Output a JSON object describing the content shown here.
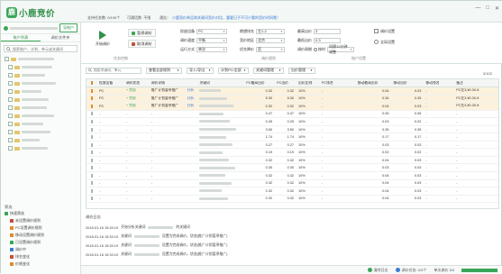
{
  "app": {
    "logo_mark": "鹿",
    "logo_text": "小鹿竞价",
    "support_label": "支持任务数: 0/100个",
    "connect_label": "可通话数: 不限",
    "notice_prefix": "通告：",
    "notice_text": "小鹿竞价单品和关键词竞价对比，重要日子不可小看的竞价时间哦！"
  },
  "window_buttons": [
    "—",
    "□",
    "✕"
  ],
  "sidebar": {
    "import_label": "导账户",
    "tabs": [
      "账户列表",
      "调价文件夹"
    ],
    "search_placeholder": "搜索账户、计划、单元或关键词",
    "filter_title": "筛选",
    "filters": [
      {
        "label": "快速筛选",
        "level": 0,
        "color": "g"
      },
      {
        "label": "未设置调价规则",
        "level": 1,
        "color": "r"
      },
      {
        "label": "PC设置调价规则",
        "level": 1,
        "color": "o"
      },
      {
        "label": "移动设置调价规则",
        "level": 1,
        "color": "o"
      },
      {
        "label": "已设置调价规则",
        "level": 1,
        "color": "g"
      },
      {
        "label": "调价中",
        "level": 1,
        "color": "b"
      },
      {
        "label": "排名变化",
        "level": 1,
        "color": "r"
      },
      {
        "label": "价格变化",
        "level": 1,
        "color": "o"
      }
    ]
  },
  "toolbar": {
    "start_label": "开始调价",
    "pause_label": "暂停调价",
    "cancel_label": "取消调价",
    "group_task": "任务控制",
    "group_rules": "调价规则",
    "group_account": "账户设置",
    "device_label": "投放设备",
    "device_value": "PC",
    "adjust_label": "调价速度",
    "adjust_value": "平衡",
    "mode_label": "运行方式",
    "mode_value": "单次",
    "rank_label": "期望排名",
    "rank_value": "左1-2",
    "area_label": "竞价地区",
    "area_value": "北京",
    "priority_label": "优先降价",
    "priority_value": "否",
    "max_label": "最高出价",
    "max_value": "3",
    "min_label": "最低出价",
    "min_value": "0.3",
    "cycle_label": "调价周期",
    "cycle_value": "按时",
    "cycle_interval": "间隔10分钟调整",
    "settings_label": "调价设置",
    "all_rules_label": "全局设置"
  },
  "gridbar": {
    "search_placeholder": "搜索关键词、单元",
    "filter_all": "查看全部规则",
    "import_label": "导入/导出",
    "device_filter": "计划PC/全部",
    "kw_action": "关键词管理",
    "export_label": "出价管理",
    "page_count": "3/102"
  },
  "table": {
    "columns": [
      "",
      "投放设备",
      "调价状态",
      "调价详情",
      "",
      "关键词",
      "PC最高出价",
      "PC出价",
      "出价比例",
      "PC排名",
      "移动最高出价",
      "移动出价",
      "移动排名",
      "备注"
    ],
    "rows": [
      {
        "sel": true,
        "device": "PC",
        "status": "+ 完成",
        "detail": "推广计划暂停推广",
        "link": "分析",
        "max": "0.32",
        "bid": "0.32",
        "ratio": "10%",
        "rank": "-",
        "mmax": "0.04",
        "mbid": "0.03",
        "mrank": "-",
        "note": "PC左3,¥0.30-¥"
      },
      {
        "sel": true,
        "device": "PC",
        "status": "+ 完成",
        "detail": "推广计划暂停推广",
        "link": "分析",
        "max": "5.30",
        "bid": "5.30",
        "ratio": "10%",
        "rank": "-",
        "mmax": "0.34",
        "mbid": "0.35",
        "mrank": "-",
        "note": "PC左3,¥0.30-¥"
      },
      {
        "sel": true,
        "device": "PC",
        "status": "+ 完成",
        "detail": "推广计划暂停推广",
        "link": "分析",
        "max": "0.32",
        "bid": "0.32",
        "ratio": "10%",
        "rank": "-",
        "mmax": "0.04",
        "mbid": "0.03",
        "mrank": "-",
        "note": "PC左3,¥0.30-¥"
      },
      {
        "sel": false,
        "device": "-",
        "status": "-",
        "detail": "-",
        "link": "",
        "max": "0.47",
        "bid": "0.47",
        "ratio": "10%",
        "rank": "-",
        "mmax": "0.05",
        "mbid": "0.05",
        "mrank": "-",
        "note": "-"
      },
      {
        "sel": false,
        "device": "-",
        "status": "-",
        "detail": "-",
        "link": "",
        "max": "0.25",
        "bid": "0.25",
        "ratio": "10%",
        "rank": "-",
        "mmax": "0.03",
        "mbid": "0.02",
        "mrank": "-",
        "note": "-"
      },
      {
        "sel": false,
        "device": "-",
        "status": "-",
        "detail": "-",
        "link": "",
        "max": "3.50",
        "bid": "3.50",
        "ratio": "10%",
        "rank": "-",
        "mmax": "0.35",
        "mbid": "0.35",
        "mrank": "-",
        "note": "-"
      },
      {
        "sel": false,
        "device": "-",
        "status": "-",
        "detail": "-",
        "link": "",
        "max": "1.74",
        "bid": "1.74",
        "ratio": "10%",
        "rank": "-",
        "mmax": "0.17",
        "mbid": "0.17",
        "mrank": "-",
        "note": "-"
      },
      {
        "sel": false,
        "device": "-",
        "status": "-",
        "detail": "-",
        "link": "",
        "max": "0.27",
        "bid": "0.27",
        "ratio": "10%",
        "rank": "-",
        "mmax": "0.03",
        "mbid": "0.03",
        "mrank": "-",
        "note": "-"
      },
      {
        "sel": false,
        "device": "-",
        "status": "-",
        "detail": "-",
        "link": "",
        "max": "0.19",
        "bid": "0.19",
        "ratio": "10%",
        "rank": "-",
        "mmax": "0.02",
        "mbid": "0.02",
        "mrank": "-",
        "note": "-"
      },
      {
        "sel": false,
        "device": "-",
        "status": "-",
        "detail": "-",
        "link": "",
        "max": "0.32",
        "bid": "0.32",
        "ratio": "10%",
        "rank": "-",
        "mmax": "0.04",
        "mbid": "0.03",
        "mrank": "-",
        "note": "-"
      },
      {
        "sel": false,
        "device": "-",
        "status": "-",
        "detail": "-",
        "link": "",
        "max": "0.30",
        "bid": "0.30",
        "ratio": "10%",
        "rank": "-",
        "mmax": "0.03",
        "mbid": "0.03",
        "mrank": "-",
        "note": "-"
      },
      {
        "sel": false,
        "device": "-",
        "status": "-",
        "detail": "-",
        "link": "",
        "max": "0.32",
        "bid": "0.32",
        "ratio": "10%",
        "rank": "-",
        "mmax": "0.04",
        "mbid": "0.03",
        "mrank": "-",
        "note": "-"
      },
      {
        "sel": false,
        "device": "-",
        "status": "-",
        "detail": "-",
        "link": "",
        "max": "0.32",
        "bid": "0.32",
        "ratio": "10%",
        "rank": "-",
        "mmax": "0.04",
        "mbid": "0.03",
        "mrank": "-",
        "note": "-"
      },
      {
        "sel": false,
        "device": "-",
        "status": "-",
        "detail": "-",
        "link": "",
        "max": "0.32",
        "bid": "0.32",
        "ratio": "10%",
        "rank": "-",
        "mmax": "0.04",
        "mbid": "0.03",
        "mrank": "-",
        "note": "-"
      },
      {
        "sel": false,
        "device": "-",
        "status": "-",
        "detail": "-",
        "link": "",
        "max": "0.32",
        "bid": "0.32",
        "ratio": "10%",
        "rank": "-",
        "mmax": "0.04",
        "mbid": "0.03",
        "mrank": "-",
        "note": "-"
      }
    ]
  },
  "log": {
    "title": "调价日志",
    "lines": [
      {
        "time": "2018-01-16 15:33:19",
        "text": "开始分析关键词",
        "tail": "的关键词"
      },
      {
        "time": "2018-01-16 15:33:19",
        "text": "关键词",
        "tail": "设置为完成调价，状态(推广计划暂停推广)"
      },
      {
        "time": "2018-01-16 15:33:19",
        "text": "关键词",
        "tail": "设置为完成调价，状态(推广计划暂停推广)"
      },
      {
        "time": "2018-01-16 15:33:19",
        "text": "关键词",
        "tail": "设置为完成调价，状态(推广计划暂停推广)"
      }
    ]
  },
  "status": {
    "clean_label": "清除日志",
    "task_label": "调价任务: 0/3个",
    "progress_label": "单次调价 3/3",
    "progress_fraction": 1.0
  }
}
